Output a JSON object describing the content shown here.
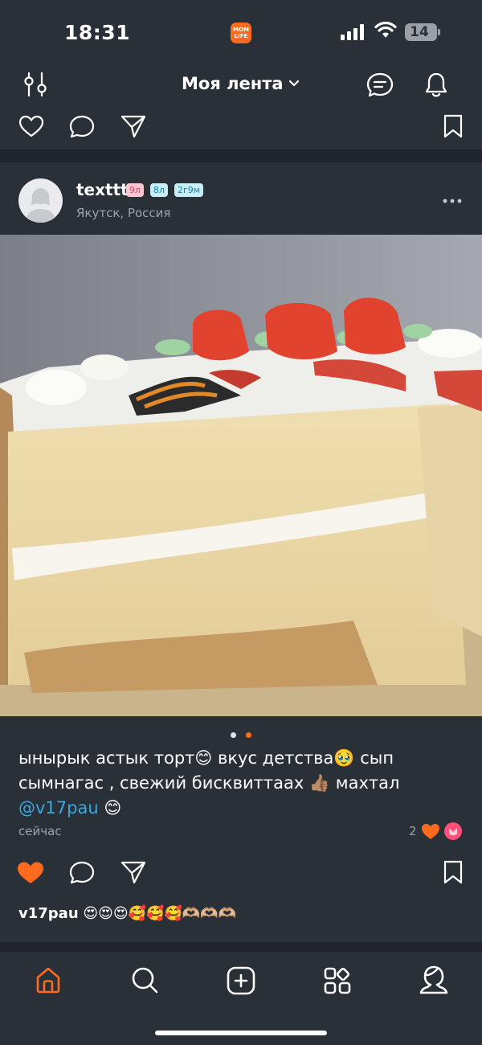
{
  "status_bar": {
    "time": "18:31",
    "app_badge_line1": "MOM",
    "app_badge_line2": "LIFE",
    "battery": "14"
  },
  "header": {
    "title": "Моя лента",
    "icons": [
      "filters-icon",
      "chevron-down-icon",
      "messages-icon",
      "bell-icon"
    ]
  },
  "prev_post_actions": [
    "heart-icon",
    "comment-icon",
    "share-icon",
    "bookmark-icon"
  ],
  "post": {
    "author": "texttt",
    "tags": [
      "9л",
      "8л",
      "2г9м"
    ],
    "location": "Якутск, Россия",
    "image_description_icon": "cake-photo",
    "carousel": {
      "count": 2,
      "active": 1
    },
    "caption_text": "ынырык астык торт😊 вкус детства🥹 сып сымнагас , свежий бисквиттаах 👍🏽 махтал ",
    "caption_mention": "@v17pau",
    "caption_end": " 😊",
    "time": "сейчас",
    "reactions_count": "2",
    "liked": true,
    "comment": {
      "author": "v17pau",
      "text": " 😍😍😍🥰🥰🥰🫶🏼🫶🏼🫶🏼"
    }
  },
  "colors": {
    "background": "#2a3038",
    "accent": "#ff6a1f",
    "mention": "#38a8e0"
  },
  "bottom_nav": [
    "home-icon",
    "search-icon",
    "add-post-icon",
    "services-icon",
    "profile-icon"
  ]
}
